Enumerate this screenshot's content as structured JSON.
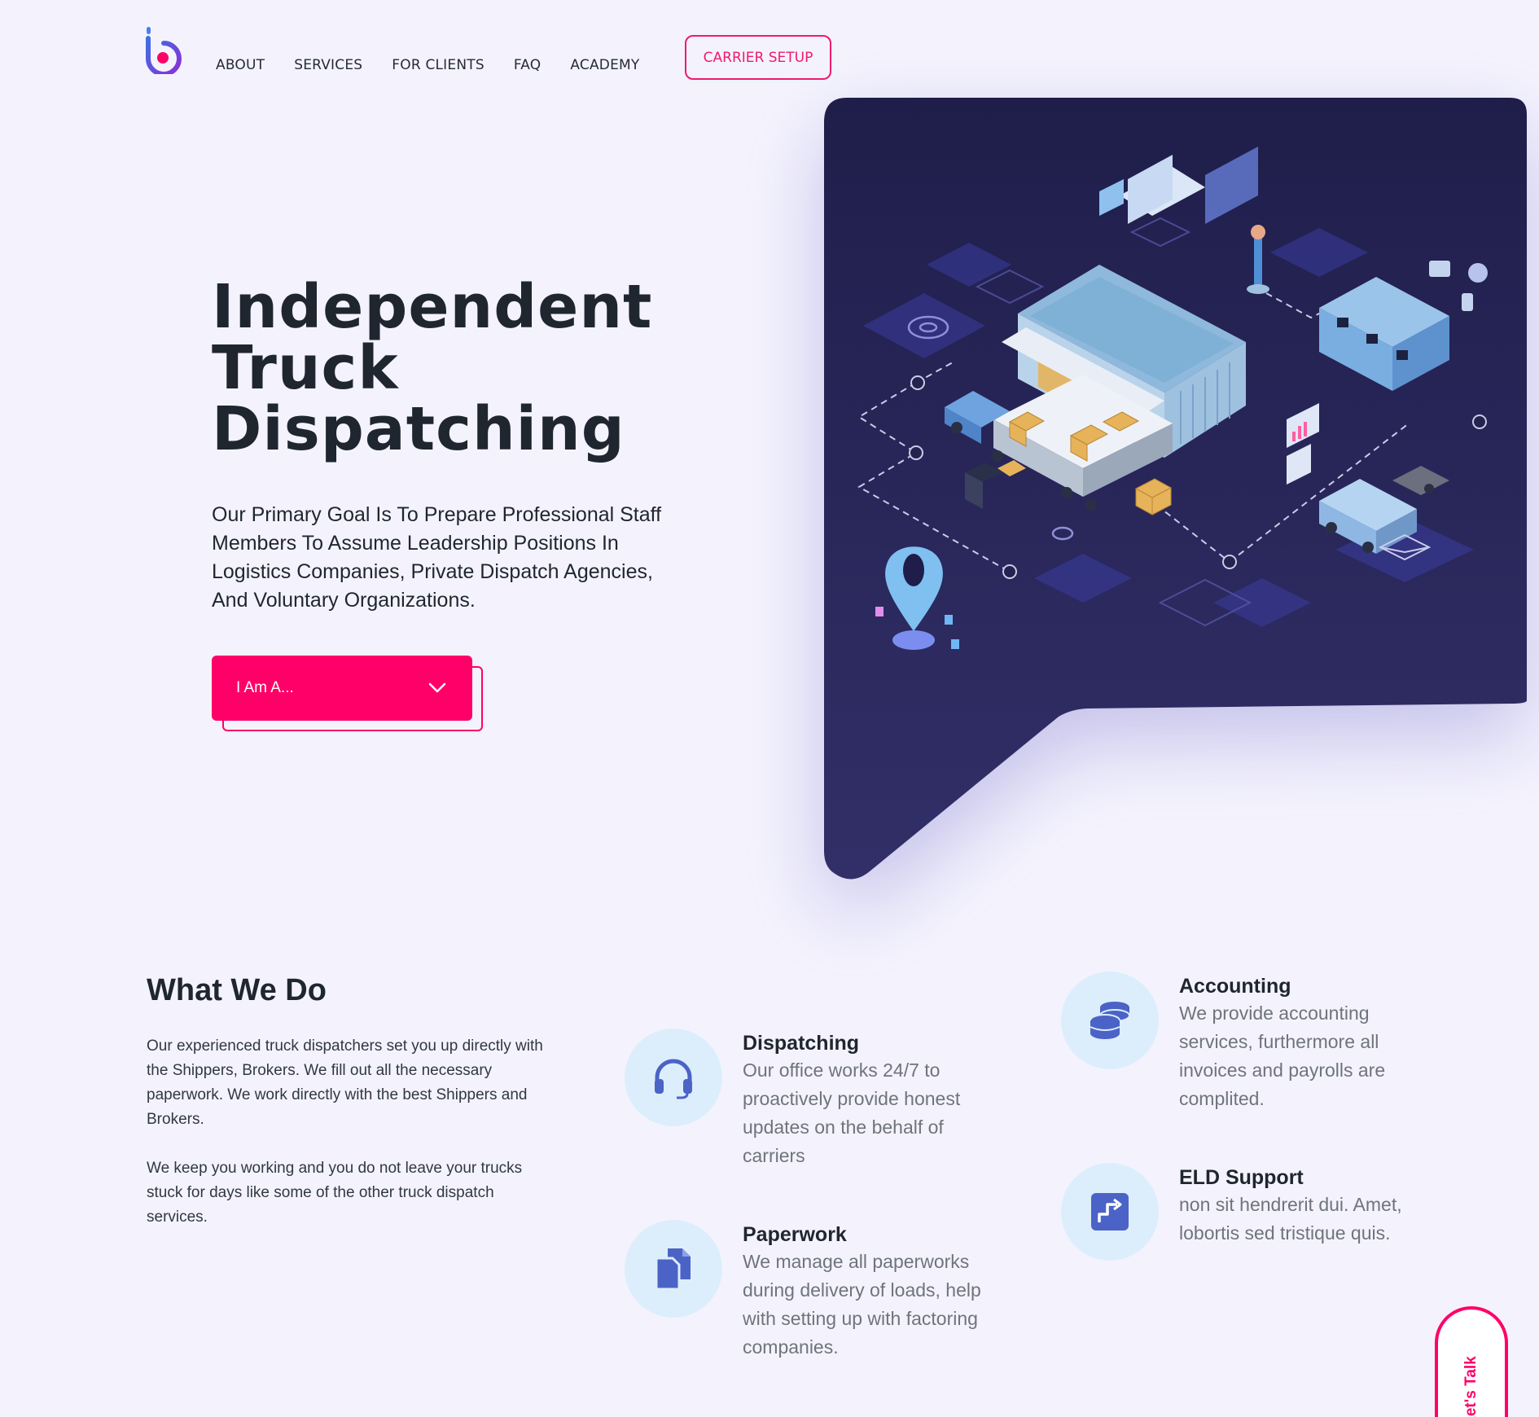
{
  "colors": {
    "accent": "#ff0068",
    "brand": "#5b3fd6",
    "panel": "#25224e",
    "icon": "#4b63c7",
    "icon_bg": "#dceefb"
  },
  "nav": {
    "items": [
      "ABOUT",
      "SERVICES",
      "FOR CLIENTS",
      "FAQ",
      "ACADEMY"
    ],
    "cta": "CARRIER SETUP"
  },
  "hero": {
    "title_lines": [
      "Independent",
      "Truck",
      "Dispatching"
    ],
    "subtitle": "Our Primary Goal Is To Prepare Professional Staff Members To Assume Leadership Positions In Logistics Companies, Private Dispatch Agencies, And Voluntary Organizations.",
    "select_label": "I Am A..."
  },
  "what_we_do": {
    "title": "What We Do",
    "paragraphs": [
      "Our experienced truck dispatchers set you up directly with the Shippers, Brokers. We fill out all the necessary paperwork. We work directly with the best Shippers and Brokers.",
      "We keep you working and you do not leave your trucks stuck for days like some of the other truck dispatch services."
    ],
    "services": [
      {
        "title": "Dispatching",
        "text": "Our office works 24/7 to proactively provide honest updates on the behalf of carriers",
        "icon": "headset-icon"
      },
      {
        "title": "Paperwork",
        "text": "We manage all paperworks during delivery of loads, help with setting up with factoring companies.",
        "icon": "documents-icon"
      },
      {
        "title": "Accounting",
        "text": "We provide accounting services, furthermore all invoices and payrolls are complited.",
        "icon": "coins-icon"
      },
      {
        "title": "ELD Support",
        "text": "non sit hendrerit dui. Amet, lobortis sed tristique quis.",
        "icon": "eld-step-icon"
      }
    ]
  },
  "chat_tab": "Let's Talk"
}
